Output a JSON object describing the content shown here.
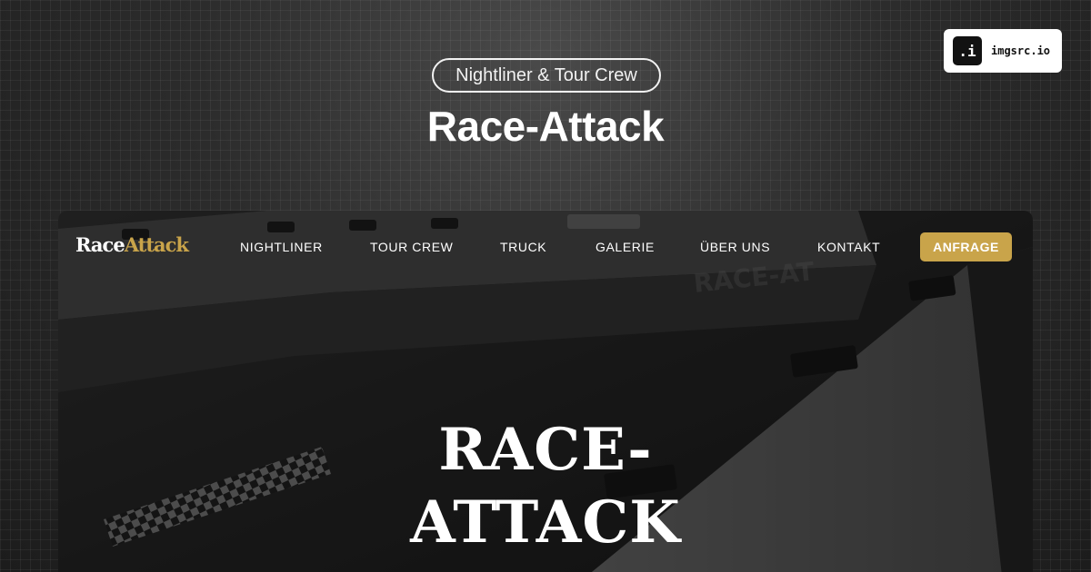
{
  "badge": {
    "icon": ".i",
    "label": "imgsrc.io"
  },
  "header": {
    "subtitle": "Nightliner & Tour Crew",
    "title": "Race-Attack"
  },
  "site": {
    "logo": {
      "part1": "Race",
      "part2": "Attack"
    },
    "nav": [
      {
        "label": "NIGHTLINER"
      },
      {
        "label": "TOUR CREW"
      },
      {
        "label": "TRUCK"
      },
      {
        "label": "GALERIE"
      },
      {
        "label": "ÜBER UNS"
      },
      {
        "label": "KONTAKT"
      }
    ],
    "cta": "ANFRAGE",
    "hero": {
      "line1": "RACE-",
      "line2": "ATTACK"
    }
  },
  "colors": {
    "accent": "#c9a44a",
    "background": "#262626",
    "text": "#ffffff"
  }
}
